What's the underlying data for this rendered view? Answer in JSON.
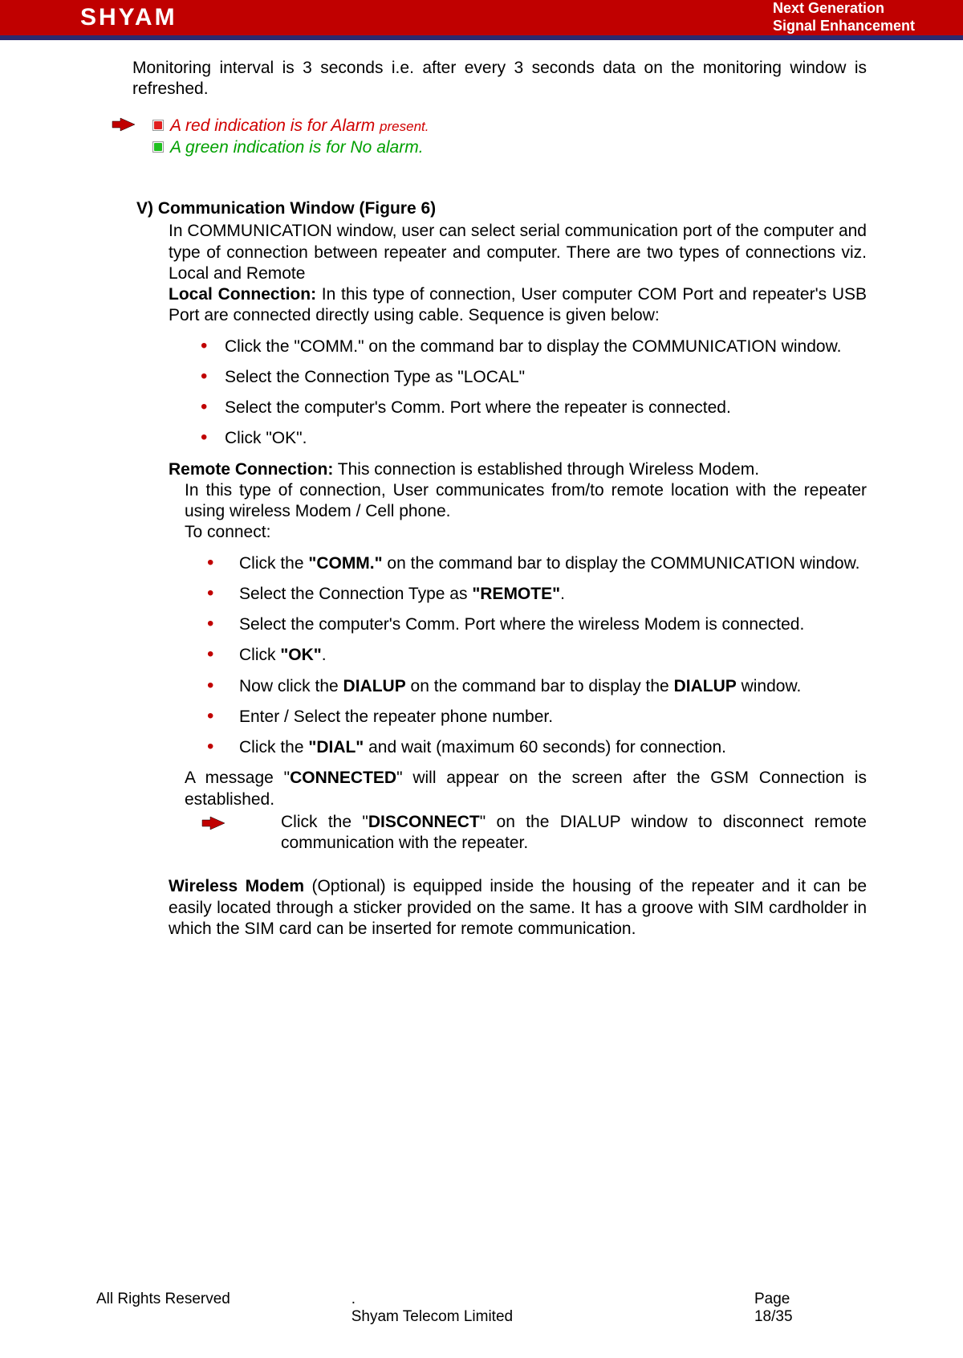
{
  "header": {
    "logo": "SHYAM",
    "tag1": "Next Generation",
    "tag2": "Signal Enhancement"
  },
  "intro": "Monitoring interval is 3 seconds i.e. after every 3 seconds data on the monitoring window is refreshed.",
  "notes": {
    "red_pre": "A red indication is for Alarm ",
    "red_suf": "present.",
    "green": "A green indication is for No alarm."
  },
  "sectionV": {
    "title": "V) Communication Window (Figure 6)",
    "p1": "In COMMUNICATION window, user can select serial communication port of the computer and type of connection between repeater and computer. There are two types of connections viz. Local and Remote",
    "local_label": "Local Connection:",
    "local_rest": " In this type of connection, User computer COM Port and repeater's USB Port are connected directly using cable. Sequence is given below:",
    "local_bullets": [
      "Click the \"COMM.\" on the command bar to display the COMMUNICATION window.",
      "Select the Connection Type as \"LOCAL\"",
      "Select the computer's Comm. Port where the repeater is connected.",
      "Click \"OK\"."
    ],
    "remote_label": "Remote Connection:",
    "remote_rest": " This connection is established through Wireless Modem.",
    "remote_sub": "In this type of connection, User communicates from/to remote location with the repeater using wireless Modem / Cell phone.",
    "to_connect": "To connect:",
    "remote_b1_a": "Click the ",
    "remote_b1_b": "\"COMM.\"",
    "remote_b1_c": " on the command bar to display the COMMUNICATION window.",
    "remote_b2_a": "Select the Connection Type as ",
    "remote_b2_b": "\"REMOTE\"",
    "remote_b2_c": ".",
    "remote_b3": "Select the computer's Comm. Port where the wireless Modem is connected.",
    "remote_b4_a": "Click ",
    "remote_b4_b": "\"OK\"",
    "remote_b4_c": ".",
    "remote_b5_a": "Now click the ",
    "remote_b5_b": "DIALUP",
    "remote_b5_c": " on the command bar to display the ",
    "remote_b5_d": "DIALUP",
    "remote_b5_e": " window.",
    "remote_b6": "Enter / Select the repeater phone number.",
    "remote_b7_a": "Click the ",
    "remote_b7_b": "\"DIAL\"",
    "remote_b7_c": " and wait (maximum 60 seconds) for connection.",
    "connected_a": "A message \"",
    "connected_b": "CONNECTED",
    "connected_c": "\" will appear on the screen after the GSM Connection is established.",
    "disconnect_a": "Click the \"",
    "disconnect_b": "DISCONNECT",
    "disconnect_c": "\" on the DIALUP window to disconnect remote communication with the repeater.",
    "wireless_a": "Wireless Modem",
    "wireless_b": " (Optional) is equipped inside the housing of the repeater and it can be easily located through a sticker provided on the same. It has a groove with SIM cardholder in which the SIM card can be inserted for remote communication."
  },
  "footer": {
    "dot": ".",
    "left": "All Rights Reserved",
    "center": "Shyam Telecom Limited",
    "right_label": "Page",
    "right_page": "18/35"
  }
}
